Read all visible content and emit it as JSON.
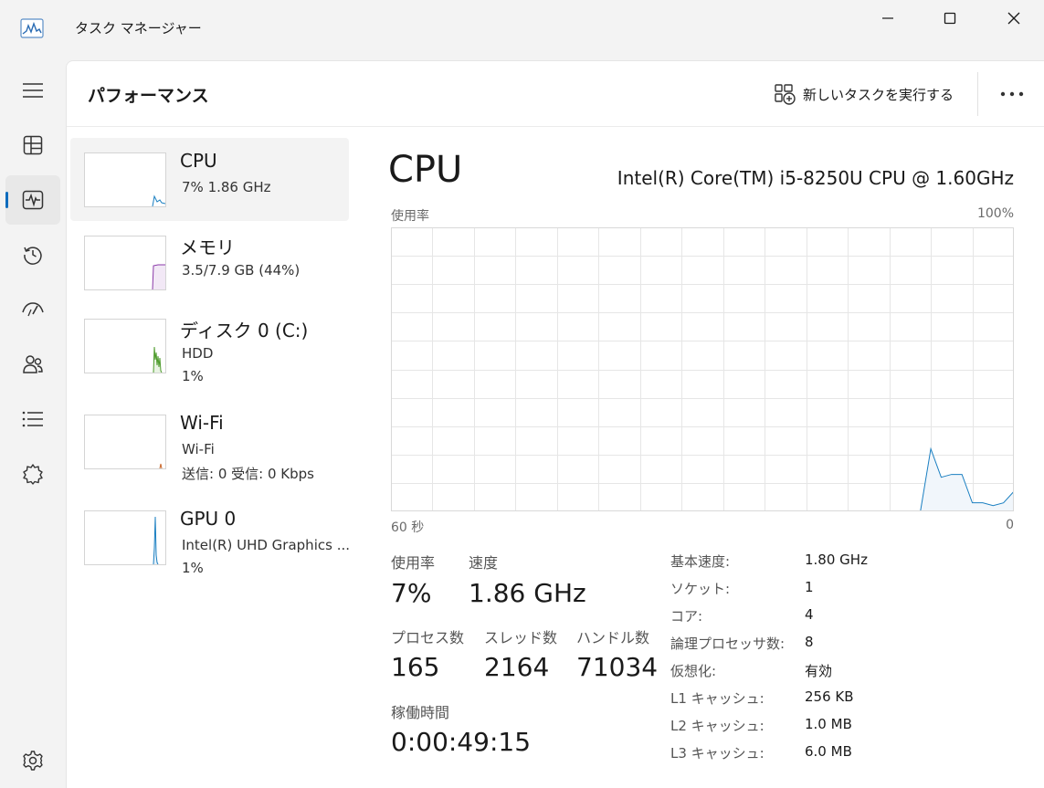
{
  "window": {
    "title": "タスク マネージャー"
  },
  "header": {
    "title": "パフォーマンス",
    "new_task_label": "新しいタスクを実行する",
    "more_label": "•••"
  },
  "rail": {
    "items": [
      {
        "icon": "hamburger-menu-icon"
      },
      {
        "icon": "processes-icon"
      },
      {
        "icon": "performance-icon",
        "active": true
      },
      {
        "icon": "app-history-icon"
      },
      {
        "icon": "startup-apps-icon"
      },
      {
        "icon": "users-icon"
      },
      {
        "icon": "details-icon"
      },
      {
        "icon": "services-icon"
      },
      {
        "icon": "settings-icon"
      }
    ]
  },
  "devices": [
    {
      "name": "CPU",
      "line1": "7%  1.86 GHz",
      "line2": "",
      "color": "#1a7fc1",
      "selected": true
    },
    {
      "name": "メモリ",
      "line1": "3.5/7.9 GB (44%)",
      "line2": "",
      "color": "#8b3aa8"
    },
    {
      "name": "ディスク 0 (C:)",
      "line1": "HDD",
      "line2": "1%",
      "color": "#4c9a2a"
    },
    {
      "name": "Wi-Fi",
      "line1": "Wi-Fi",
      "line2": "送信: 0  受信: 0 Kbps",
      "color": "#c9662a"
    },
    {
      "name": "GPU 0",
      "line1": "Intel(R) UHD Graphics ...",
      "line2": "1%",
      "color": "#1a7fc1"
    }
  ],
  "cpu": {
    "title": "CPU",
    "model": "Intel(R) Core(TM) i5-8250U CPU @ 1.60GHz",
    "graph_top_left": "使用率",
    "graph_top_right": "100%",
    "graph_bottom_left": "60 秒",
    "graph_bottom_right": "0",
    "line_color": "#1a7fc1",
    "usage_history": [
      0,
      22,
      12,
      13,
      13,
      3,
      3,
      2,
      3,
      7
    ]
  },
  "stats": {
    "usage_label": "使用率",
    "usage_value": "7%",
    "speed_label": "速度",
    "speed_value": "1.86 GHz",
    "processes_label": "プロセス数",
    "processes_value": "165",
    "threads_label": "スレッド数",
    "threads_value": "2164",
    "handles_label": "ハンドル数",
    "handles_value": "71034",
    "uptime_label": "稼働時間",
    "uptime_value": "0:00:49:15"
  },
  "specs": [
    {
      "key": "基本速度:",
      "value": "1.80 GHz"
    },
    {
      "key": "ソケット:",
      "value": "1"
    },
    {
      "key": "コア:",
      "value": "4"
    },
    {
      "key": "論理プロセッサ数:",
      "value": "8"
    },
    {
      "key": "仮想化:",
      "value": "有効"
    },
    {
      "key": "L1 キャッシュ:",
      "value": "256 KB"
    },
    {
      "key": "L2 キャッシュ:",
      "value": "1.0 MB"
    },
    {
      "key": "L3 キャッシュ:",
      "value": "6.0 MB"
    }
  ]
}
